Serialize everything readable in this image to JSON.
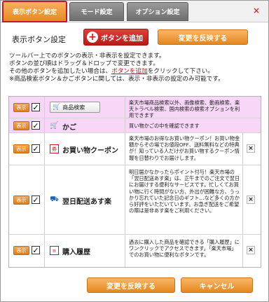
{
  "tabs": [
    {
      "label": "表示ボタン設定"
    },
    {
      "label": "モード設定"
    },
    {
      "label": "オプション設定"
    }
  ],
  "close_label": "×",
  "header": {
    "title": "表示ボタン設定",
    "add_button": "ボタンを追加",
    "apply_button": "変更を反映する"
  },
  "description": {
    "line1": "ツールバー上でのボタンの表示・非表示を設定できます。",
    "line2": "ボタンの並び順はドラッグ＆ドロップで変更できます。",
    "line3_pre": "その他のボタンを追加したい場合は、",
    "line3_link": "ボタンを追加",
    "line3_post": "をクリックして下さい。",
    "line4": "※商品検索ボタン＆かごボタンに関しては、表示・非表示の設定のみ可能です。"
  },
  "show_label": "表示",
  "check_mark": "✓",
  "delete_mark": "×",
  "rows": [
    {
      "label": "商品検索",
      "desc": "楽天市場商品検索以外、画像検索、動画検索、楽天トラベル検索、国内検索の検索オプションを利用できます"
    },
    {
      "label": "かご",
      "desc": "買い物かごの中を確認できます"
    },
    {
      "label": "お買い物クーポン",
      "desc": "楽天市場のお得なお買い物クーポン！お買い物金額からその場でお値段OFF、送料無料などの特典が！知っている人だけがお買い物するクーポン情報を日替わりでお届けします。"
    },
    {
      "label": "翌日配送あす楽",
      "desc": "明日届かなかったらポイント付与！楽天市場の「翌日配送あす楽」は、正午までのご注文で翌日にお届けする便利なサービスです。忙しくてお買い物に行く時間がない方、外出が困難な方、うっかり忘れていた記念日のギフト…など多くの方から好評をいただいています。お急ぎ配送をご希望の際は是非あす楽をご利用ください。"
    },
    {
      "label": "購入履歴",
      "desc": "過去に購入した商品を確認できる「購入履歴」にワンクリックでアクセスできます。「楽天市場」でのお買い物に便利なボタンです。"
    }
  ],
  "footer": {
    "apply_button": "変更を反映する",
    "cancel_button": "キャンセル"
  }
}
